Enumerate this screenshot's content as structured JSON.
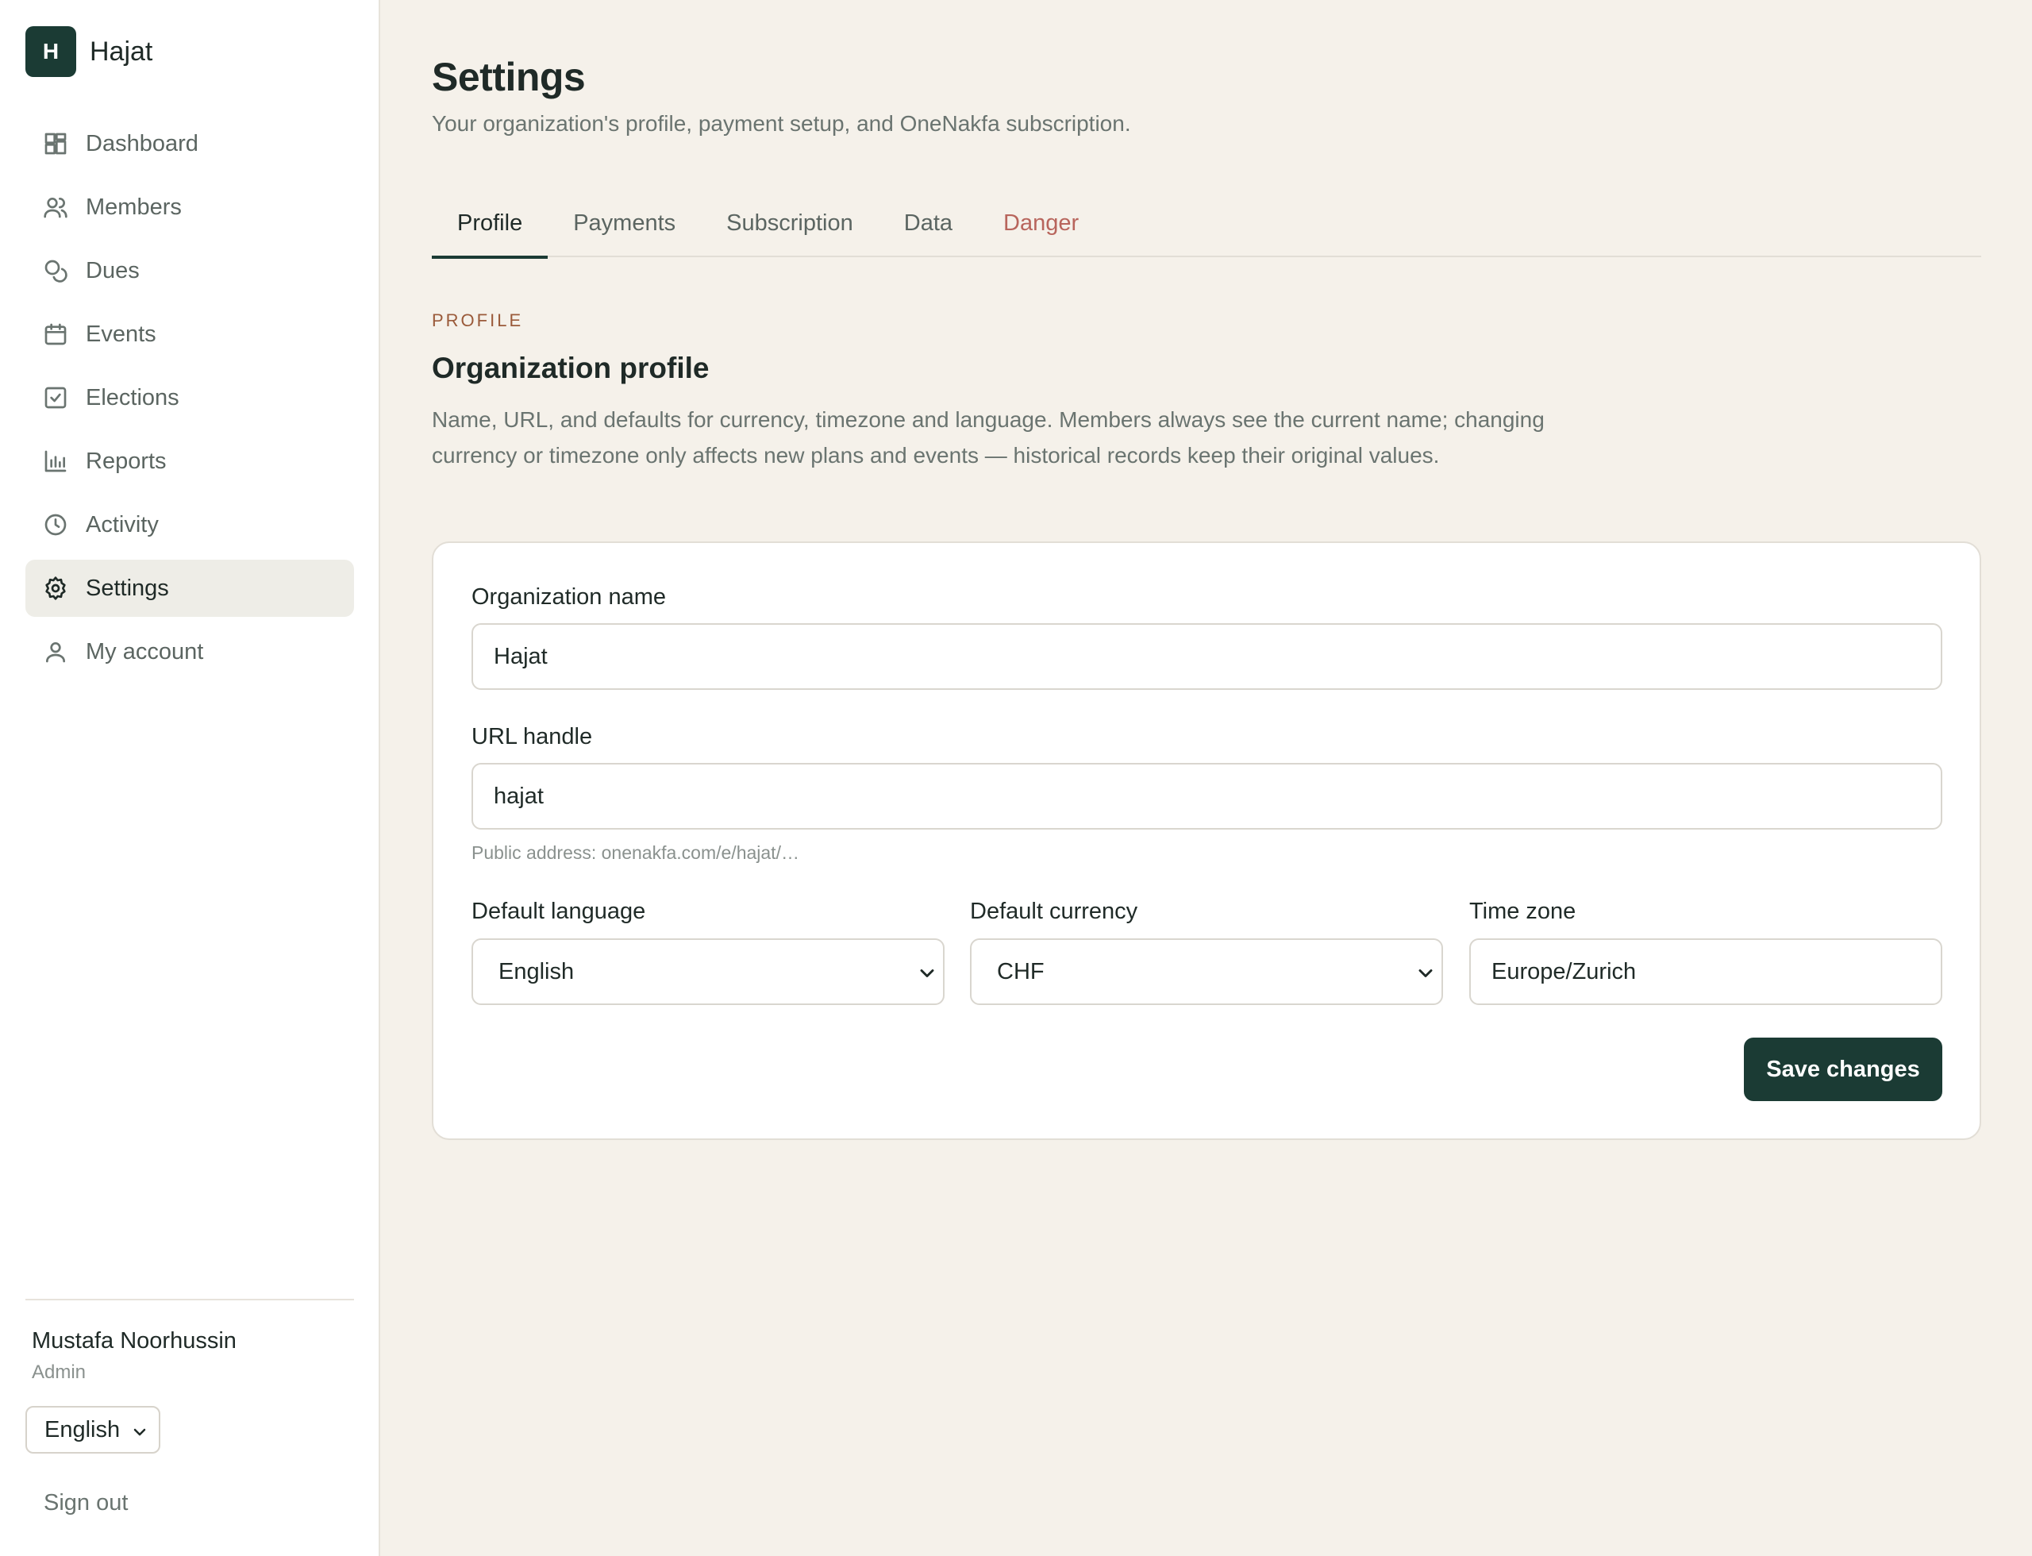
{
  "brand": {
    "initial": "H",
    "name": "Hajat"
  },
  "sidebar": {
    "items": [
      {
        "label": "Dashboard",
        "icon": "dashboard-icon"
      },
      {
        "label": "Members",
        "icon": "users-icon"
      },
      {
        "label": "Dues",
        "icon": "coins-icon"
      },
      {
        "label": "Events",
        "icon": "calendar-icon"
      },
      {
        "label": "Elections",
        "icon": "checkbox-icon"
      },
      {
        "label": "Reports",
        "icon": "bar-chart-icon"
      },
      {
        "label": "Activity",
        "icon": "clock-icon"
      },
      {
        "label": "Settings",
        "icon": "gear-icon",
        "active": true
      },
      {
        "label": "My account",
        "icon": "user-icon"
      }
    ],
    "user": {
      "name": "Mustafa Noorhussin",
      "role": "Admin"
    },
    "language": "English",
    "signout_label": "Sign out"
  },
  "page": {
    "title": "Settings",
    "subtitle": "Your organization's profile, payment setup, and OneNakfa subscription."
  },
  "tabs": [
    {
      "label": "Profile",
      "active": true
    },
    {
      "label": "Payments"
    },
    {
      "label": "Subscription"
    },
    {
      "label": "Data"
    },
    {
      "label": "Danger",
      "danger": true
    }
  ],
  "section": {
    "kicker": "PROFILE",
    "title": "Organization profile",
    "description": "Name, URL, and defaults for currency, timezone and language. Members always see the current name; changing currency or timezone only affects new plans and events — historical records keep their original values."
  },
  "form": {
    "org_name": {
      "label": "Organization name",
      "value": "Hajat"
    },
    "url_handle": {
      "label": "URL handle",
      "value": "hajat",
      "hint": "Public address: onenakfa.com/e/hajat/…"
    },
    "default_language": {
      "label": "Default language",
      "value": "English"
    },
    "default_currency": {
      "label": "Default currency",
      "value": "CHF"
    },
    "time_zone": {
      "label": "Time zone",
      "value": "Europe/Zurich"
    },
    "save_label": "Save changes"
  },
  "colors": {
    "accent": "#1b3b34",
    "background": "#f5f1ea",
    "danger": "#b8655c",
    "kicker": "#9a5a3a"
  }
}
